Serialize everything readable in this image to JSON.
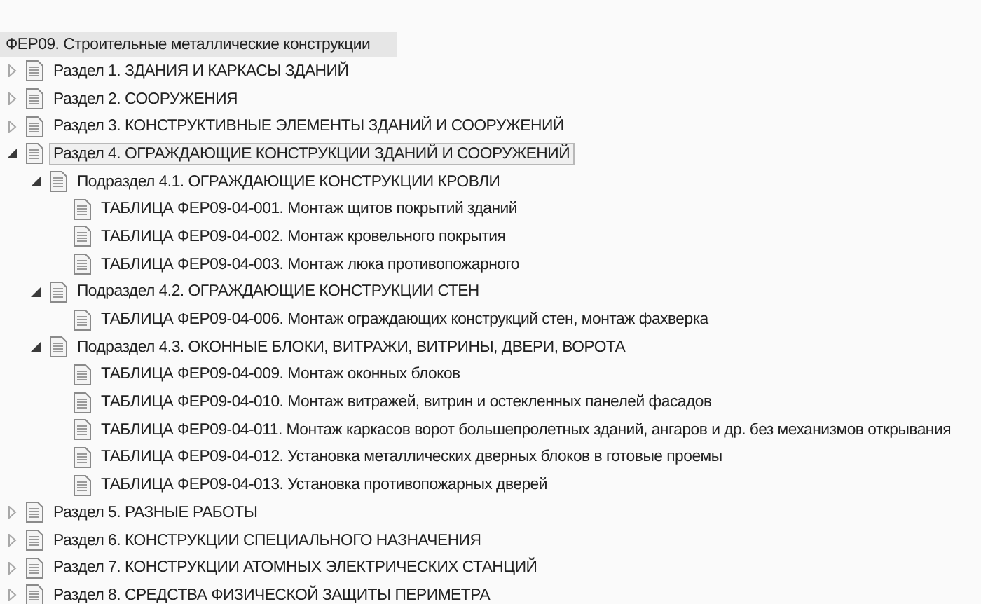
{
  "root": {
    "title": "ФЕР09. Строительные металлические конструкции"
  },
  "items": [
    {
      "label": "Раздел 1. ЗДАНИЯ И КАРКАСЫ ЗДАНИЙ",
      "expanded": false,
      "selected": false
    },
    {
      "label": "Раздел 2. СООРУЖЕНИЯ",
      "expanded": false,
      "selected": false
    },
    {
      "label": "Раздел 3. КОНСТРУКТИВНЫЕ ЭЛЕМЕНТЫ ЗДАНИЙ И СООРУЖЕНИЙ",
      "expanded": false,
      "selected": false
    },
    {
      "label": "Раздел 4. ОГРАЖДАЮЩИЕ КОНСТРУКЦИИ ЗДАНИЙ И СООРУЖЕНИЙ",
      "expanded": true,
      "selected": true,
      "children": [
        {
          "label": "Подраздел 4.1. ОГРАЖДАЮЩИЕ КОНСТРУКЦИИ КРОВЛИ",
          "expanded": true,
          "selected": false,
          "children": [
            {
              "label": "ТАБЛИЦА ФЕР09-04-001. Монтаж щитов покрытий зданий",
              "selected": false
            },
            {
              "label": "ТАБЛИЦА ФЕР09-04-002. Монтаж кровельного покрытия",
              "selected": false
            },
            {
              "label": "ТАБЛИЦА ФЕР09-04-003. Монтаж люка противопожарного",
              "selected": false
            }
          ]
        },
        {
          "label": "Подраздел 4.2. ОГРАЖДАЮЩИЕ КОНСТРУКЦИИ СТЕН",
          "expanded": true,
          "selected": false,
          "children": [
            {
              "label": "ТАБЛИЦА ФЕР09-04-006. Монтаж ограждающих конструкций стен, монтаж фахверка",
              "selected": false
            }
          ]
        },
        {
          "label": "Подраздел 4.3. ОКОННЫЕ БЛОКИ, ВИТРАЖИ, ВИТРИНЫ, ДВЕРИ, ВОРОТА",
          "expanded": true,
          "selected": false,
          "children": [
            {
              "label": "ТАБЛИЦА ФЕР09-04-009. Монтаж оконных блоков",
              "selected": false
            },
            {
              "label": "ТАБЛИЦА ФЕР09-04-010. Монтаж витражей, витрин и остекленных панелей фасадов",
              "selected": false
            },
            {
              "label": "ТАБЛИЦА ФЕР09-04-011. Монтаж каркасов ворот большепролетных зданий, ангаров и др. без механизмов открывания",
              "selected": false
            },
            {
              "label": "ТАБЛИЦА ФЕР09-04-012. Установка металлических дверных блоков в готовые проемы",
              "selected": false
            },
            {
              "label": "ТАБЛИЦА ФЕР09-04-013. Установка противопожарных дверей",
              "selected": false
            }
          ]
        }
      ]
    },
    {
      "label": "Раздел 5. РАЗНЫЕ РАБОТЫ",
      "expanded": false,
      "selected": false
    },
    {
      "label": "Раздел 6. КОНСТРУКЦИИ СПЕЦИАЛЬНОГО НАЗНАЧЕНИЯ",
      "expanded": false,
      "selected": false
    },
    {
      "label": "Раздел 7. КОНСТРУКЦИИ АТОМНЫХ ЭЛЕКТРИЧЕСКИХ СТАНЦИЙ",
      "expanded": false,
      "selected": false
    },
    {
      "label": "Раздел 8. СРЕДСТВА ФИЗИЧЕСКОЙ ЗАЩИТЫ ПЕРИМЕТРА",
      "expanded": false,
      "selected": false
    }
  ]
}
